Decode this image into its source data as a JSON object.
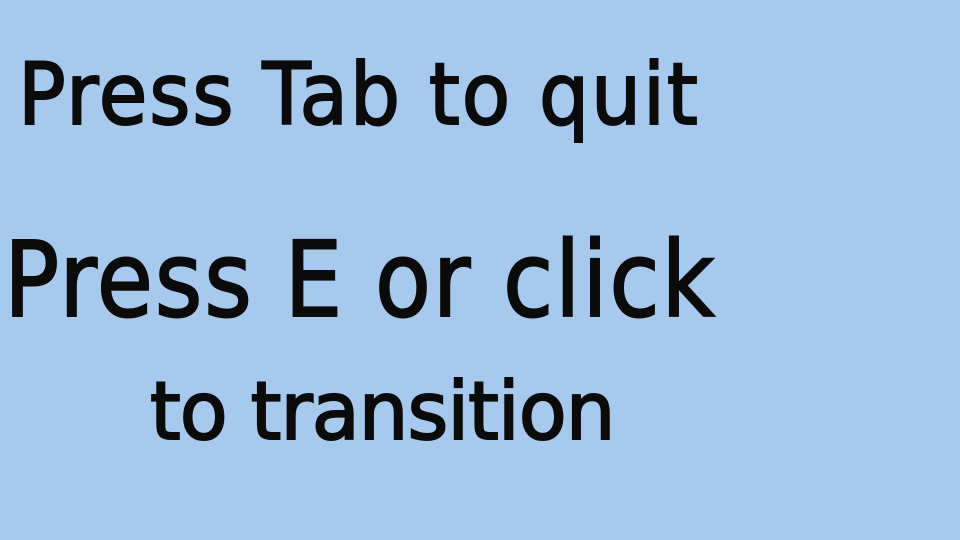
{
  "screen": {
    "background_color": "#a7c9ee",
    "text_color": "#0b0b0b",
    "quit_instruction": "Press Tab to  quit",
    "transition_instruction_line1": "Press E or  click",
    "transition_instruction_line2": "to transition"
  }
}
